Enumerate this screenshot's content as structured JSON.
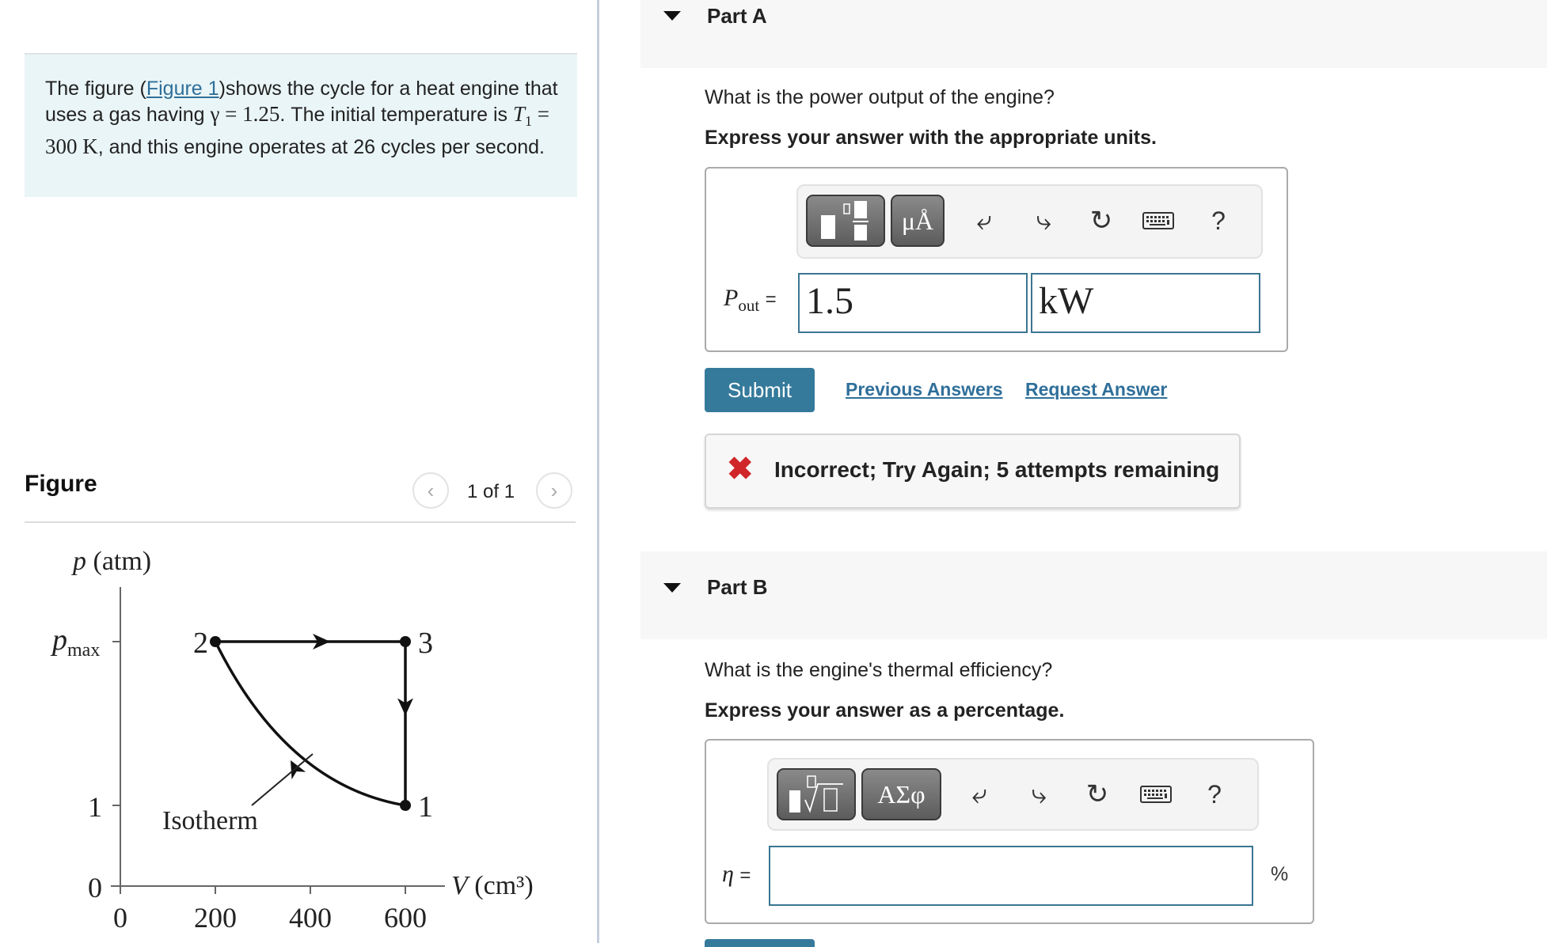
{
  "problem": {
    "intro_prefix": "The figure (",
    "figure_link": "Figure 1",
    "intro_mid1": ")shows the cycle for a heat engine that uses a gas having ",
    "gamma_expr": "γ = 1.25",
    "intro_mid2": ". The initial temperature is ",
    "temp_var": "T",
    "temp_sub": "1",
    "temp_expr": " = 300 K",
    "intro_suffix": ", and this engine operates at 26 cycles per second."
  },
  "figure_panel": {
    "title": "Figure",
    "counter": "1 of 1",
    "prev_icon": "chevron-left-icon",
    "next_icon": "chevron-right-icon"
  },
  "chart_data": {
    "type": "line",
    "title": "",
    "xlabel": "V (cm³)",
    "ylabel": "p (atm)",
    "x_ticks": [
      0,
      200,
      400,
      600
    ],
    "y_ticks": [
      {
        "value": 0,
        "label": "0"
      },
      {
        "value": 1,
        "label": "1"
      },
      {
        "value": "pmax",
        "label": "pmax"
      }
    ],
    "xlim": [
      0,
      700
    ],
    "points": [
      {
        "label": "1",
        "V": 600,
        "p": 1
      },
      {
        "label": "2",
        "V": 200,
        "p": "pmax"
      },
      {
        "label": "3",
        "V": 600,
        "p": "pmax"
      }
    ],
    "segments": [
      {
        "from": "2",
        "to": "3",
        "process": "isobaric"
      },
      {
        "from": "3",
        "to": "1",
        "process": "isochoric"
      },
      {
        "from": "1",
        "to": "2",
        "process": "isothermal"
      }
    ],
    "annotation": "Isotherm",
    "grid": false
  },
  "partA": {
    "label": "Part A",
    "question": "What is the power output of the engine?",
    "instruction": "Express your answer with the appropriate units.",
    "toolbar": {
      "template_icon": "fraction-template-icon",
      "units_label": "μÅ",
      "undo_icon": "undo-icon",
      "redo_icon": "redo-icon",
      "reset_icon": "reset-icon",
      "keyboard_icon": "keyboard-icon",
      "help_label": "?"
    },
    "var_main": "P",
    "var_sub": "out",
    "equals": "=",
    "value": "1.5",
    "units": "kW",
    "submit_label": "Submit",
    "previous_answers": "Previous Answers",
    "request_answer": "Request Answer",
    "feedback": "Incorrect; Try Again; 5 attempts remaining",
    "feedback_color": "#d0262a"
  },
  "partB": {
    "label": "Part B",
    "question": "What is the engine's thermal efficiency?",
    "instruction": "Express your answer as a percentage.",
    "toolbar": {
      "template_icon": "radical-template-icon",
      "symbols_label": "ΑΣφ",
      "undo_icon": "undo-icon",
      "redo_icon": "redo-icon",
      "reset_icon": "reset-icon",
      "keyboard_icon": "keyboard-icon",
      "help_label": "?"
    },
    "var": "η",
    "equals": "=",
    "value": "",
    "units": "%"
  },
  "colors": {
    "accent": "#357a9b",
    "link": "#2f6f9a",
    "intro_bg": "#eaf5f7",
    "part_header_bg": "#f7f7f7",
    "input_border": "#3a7592"
  }
}
